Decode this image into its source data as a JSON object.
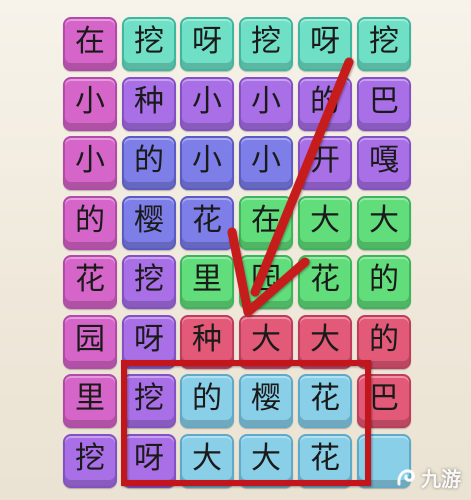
{
  "colors": {
    "pink": "#d665c9",
    "teal": "#6fe0c6",
    "purple": "#a86fe6",
    "blue": "#7d7ee8",
    "green": "#62dd7b",
    "red": "#e25a78",
    "sky": "#89cfe8",
    "highlight": "#c2121c",
    "arrow": "#c61a1a"
  },
  "grid": [
    [
      {
        "char": "在",
        "color": "pink"
      },
      {
        "char": "挖",
        "color": "teal"
      },
      {
        "char": "呀",
        "color": "teal"
      },
      {
        "char": "挖",
        "color": "teal"
      },
      {
        "char": "呀",
        "color": "teal"
      },
      {
        "char": "挖",
        "color": "teal"
      }
    ],
    [
      {
        "char": "小",
        "color": "pink"
      },
      {
        "char": "种",
        "color": "purple"
      },
      {
        "char": "小",
        "color": "purple"
      },
      {
        "char": "小",
        "color": "purple"
      },
      {
        "char": "的",
        "color": "purple"
      },
      {
        "char": "巴",
        "color": "purple"
      }
    ],
    [
      {
        "char": "小",
        "color": "pink"
      },
      {
        "char": "的",
        "color": "blue"
      },
      {
        "char": "小",
        "color": "blue"
      },
      {
        "char": "小",
        "color": "blue"
      },
      {
        "char": "开",
        "color": "purple"
      },
      {
        "char": "嘎",
        "color": "purple"
      }
    ],
    [
      {
        "char": "的",
        "color": "pink"
      },
      {
        "char": "樱",
        "color": "blue"
      },
      {
        "char": "花",
        "color": "blue"
      },
      {
        "char": "在",
        "color": "green"
      },
      {
        "char": "大",
        "color": "green"
      },
      {
        "char": "大",
        "color": "green"
      }
    ],
    [
      {
        "char": "花",
        "color": "pink"
      },
      {
        "char": "挖",
        "color": "purple"
      },
      {
        "char": "里",
        "color": "green"
      },
      {
        "char": "园",
        "color": "green"
      },
      {
        "char": "花",
        "color": "green"
      },
      {
        "char": "的",
        "color": "green"
      }
    ],
    [
      {
        "char": "园",
        "color": "pink"
      },
      {
        "char": "呀",
        "color": "purple"
      },
      {
        "char": "种",
        "color": "red"
      },
      {
        "char": "大",
        "color": "red"
      },
      {
        "char": "大",
        "color": "red"
      },
      {
        "char": "的",
        "color": "red"
      }
    ],
    [
      {
        "char": "里",
        "color": "pink"
      },
      {
        "char": "挖",
        "color": "purple"
      },
      {
        "char": "的",
        "color": "sky"
      },
      {
        "char": "樱",
        "color": "sky"
      },
      {
        "char": "花",
        "color": "sky"
      },
      {
        "char": "巴",
        "color": "red"
      }
    ],
    [
      {
        "char": "挖",
        "color": "purple"
      },
      {
        "char": "呀",
        "color": "purple"
      },
      {
        "char": "大",
        "color": "sky"
      },
      {
        "char": "大",
        "color": "sky"
      },
      {
        "char": "花",
        "color": "sky"
      },
      {
        "char": "",
        "color": "sky"
      }
    ]
  ],
  "watermark": {
    "text": "九游",
    "icon": "jiuyou-logo-icon"
  }
}
